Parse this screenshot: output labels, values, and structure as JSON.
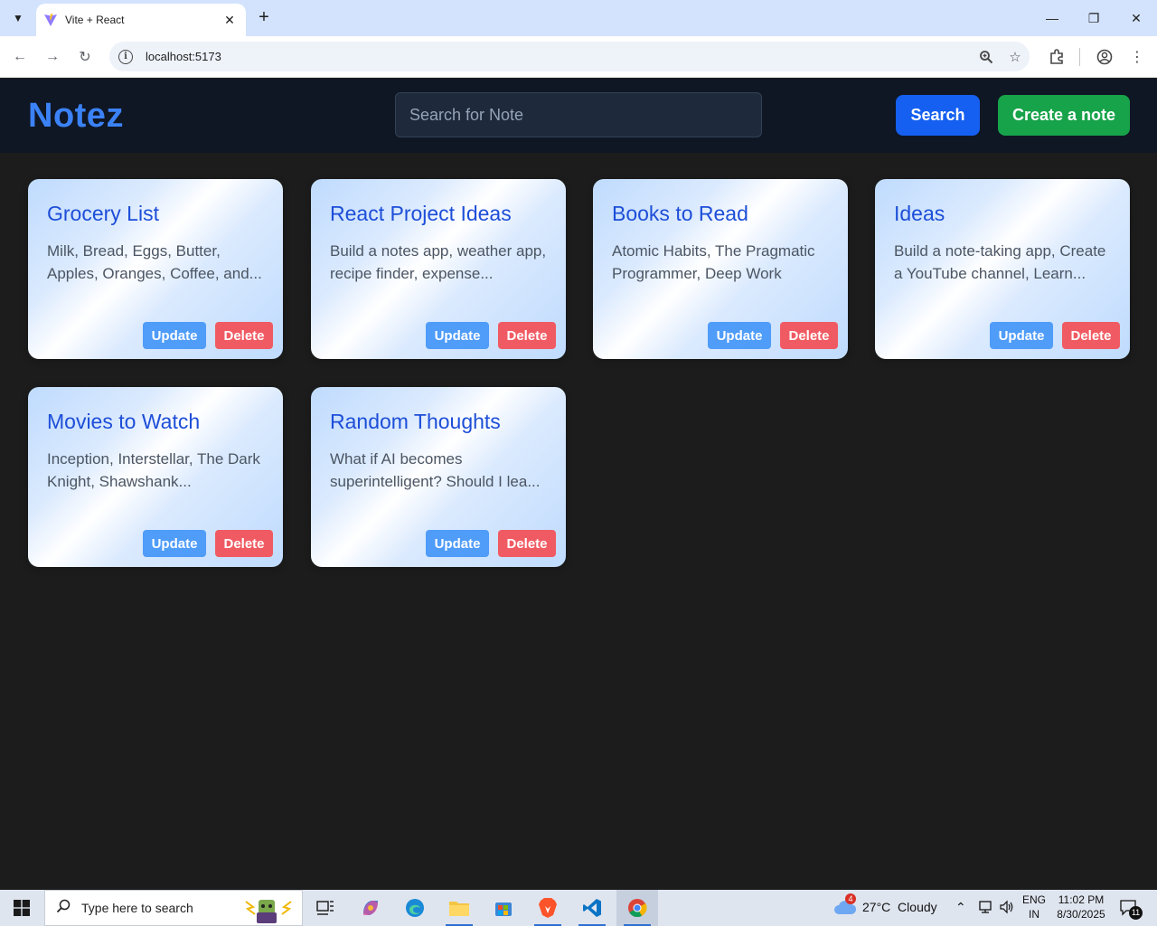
{
  "browser": {
    "tab_title": "Vite + React",
    "tab_close": "✕",
    "new_tab": "+",
    "url": "localhost:5173"
  },
  "app": {
    "logo": "Notez",
    "search_placeholder": "Search for Note",
    "search_button": "Search",
    "create_button": "Create a note"
  },
  "notes": [
    {
      "title": "Grocery List",
      "body": "Milk, Bread, Eggs, Butter, Apples, Oranges, Coffee, and...",
      "update": "Update",
      "delete": "Delete"
    },
    {
      "title": "React Project Ideas",
      "body": "Build a notes app, weather app, recipe finder, expense...",
      "update": "Update",
      "delete": "Delete"
    },
    {
      "title": "Books to Read",
      "body": "Atomic Habits, The Pragmatic Programmer, Deep Work",
      "update": "Update",
      "delete": "Delete"
    },
    {
      "title": "Ideas",
      "body": "Build a note-taking app, Create a YouTube channel, Learn...",
      "update": "Update",
      "delete": "Delete"
    },
    {
      "title": "Movies to Watch",
      "body": "Inception, Interstellar, The Dark Knight, Shawshank...",
      "update": "Update",
      "delete": "Delete"
    },
    {
      "title": "Random Thoughts",
      "body": "What if AI becomes superintelligent? Should I lea...",
      "update": "Update",
      "delete": "Delete"
    }
  ],
  "taskbar": {
    "search_placeholder": "Type here to search",
    "weather_badge": "4",
    "weather": "27°C  Cloudy",
    "lang_top": "ENG",
    "lang_bottom": "IN",
    "time": "11:02 PM",
    "date": "8/30/2025",
    "notifications": "11"
  },
  "colors": {
    "app_bg": "#1c1c1c",
    "header_bg": "#0f1624",
    "logo": "#3b82f6",
    "search_btn": "#1560f0",
    "create_btn": "#17a34a",
    "update_btn": "#4f9cf9",
    "delete_btn": "#f05b63",
    "note_title": "#1d4ed8"
  }
}
